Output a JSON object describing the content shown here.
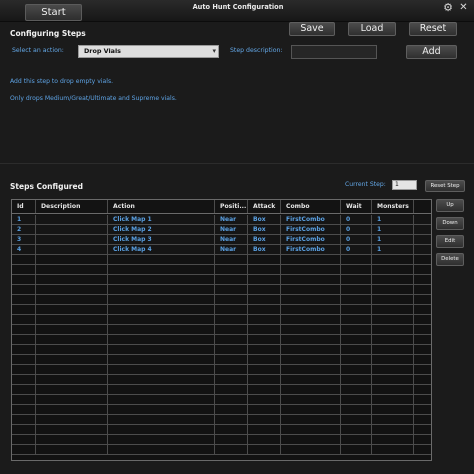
{
  "window": {
    "title": "Auto Hunt Configuration",
    "start_label": "Start",
    "settings_icon": "gear-icon",
    "close_icon": "close-icon"
  },
  "configuring": {
    "title": "Configuring Steps",
    "save_label": "Save",
    "load_label": "Load",
    "reset_label": "Reset",
    "add_label": "Add",
    "action_label": "Select an action:",
    "action_value": "Drop Vials",
    "description_label": "Step description:",
    "description_value": "",
    "info_lines": [
      "Add this step to drop empty vials.",
      "Only drops Medium/Great/Ultimate and Supreme vials."
    ]
  },
  "steps": {
    "title": "Steps Configured",
    "current_step_label": "Current Step:",
    "current_step_value": "1",
    "reset_step_label": "Reset Step",
    "up_label": "Up",
    "down_label": "Down",
    "edit_label": "Edit",
    "delete_label": "Delete",
    "columns": [
      "Id",
      "Description",
      "Action",
      "Positi...",
      "Attack",
      "Combo",
      "Wait",
      "Monsters"
    ],
    "rows": [
      [
        "1",
        "",
        "Click Map 1",
        "Near",
        "Box",
        "FirstCombo",
        "0",
        "1"
      ],
      [
        "2",
        "",
        "Click Map 2",
        "Near",
        "Box",
        "FirstCombo",
        "0",
        "1"
      ],
      [
        "3",
        "",
        "Click Map 3",
        "Near",
        "Box",
        "FirstCombo",
        "0",
        "1"
      ],
      [
        "4",
        "",
        "Click Map 4",
        "Near",
        "Box",
        "FirstCombo",
        "0",
        "1"
      ]
    ],
    "empty_row_count": 20
  },
  "colors": {
    "accent_text": "#63a7e6",
    "background": "#1b1b1b"
  }
}
